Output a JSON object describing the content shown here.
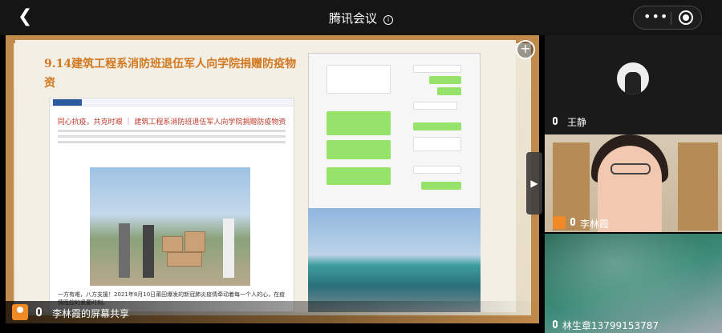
{
  "topbar": {
    "back_icon": "chevron-left-icon",
    "title": "腾讯会议",
    "info_icon": "info-icon",
    "more_icon": "more-icon",
    "record_icon": "record-icon"
  },
  "share": {
    "slide_title": "9.14建筑工程系消防班退伍军人向学院捐赠防疫物资",
    "article_title": "同心抗疫，共克时艰 ｜ 建筑工程系消防班退伍军人向学院捐赠防疫物资",
    "article_caption": "一方有难，八方支援！2021年8月10日莆田爆发的新冠肺炎疫情牵动着每一个人的心，在疫情阻控的紧要时刻。",
    "sharer_label": "李林霞的屏幕共享",
    "zoom_icon": "zoom-in-icon"
  },
  "participants": [
    {
      "name": "王静",
      "muted": true
    },
    {
      "name": "李林霞",
      "muted": false
    },
    {
      "name": "林生章13799153787",
      "muted": false
    }
  ],
  "colors": {
    "accent": "#f08a24",
    "slide_title": "#d17820",
    "frame": "#c08a4a",
    "chat_green": "#95e36b"
  }
}
